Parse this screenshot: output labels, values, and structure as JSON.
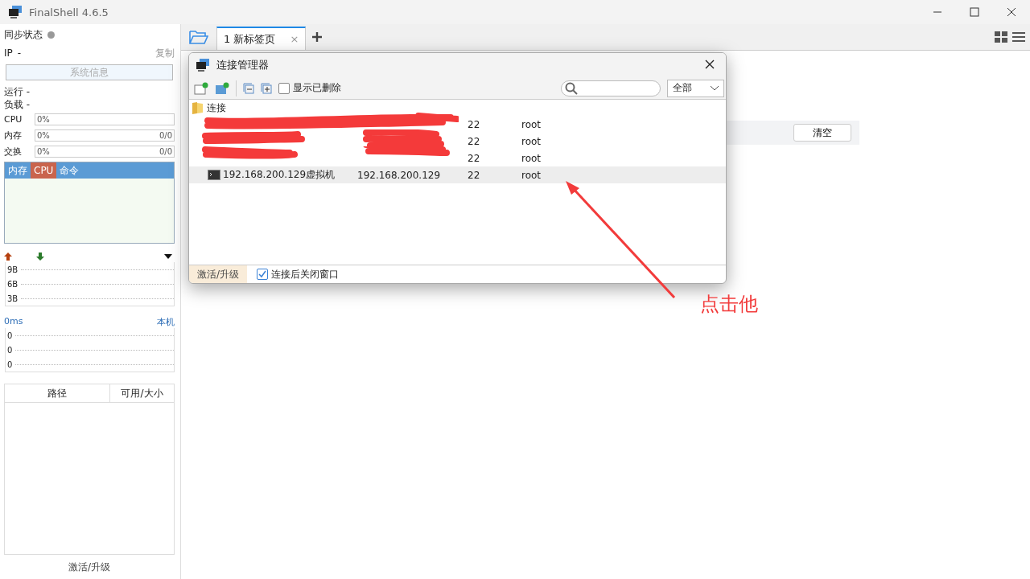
{
  "window": {
    "title": "FinalShell 4.6.5"
  },
  "sidebar": {
    "sync": {
      "label": "同步状态",
      "on": false
    },
    "ip": {
      "label": "IP",
      "value": "-",
      "action": "复制"
    },
    "sysinfo_button": "系统信息",
    "uptime": "运行 -",
    "load": "负载 -",
    "meters": [
      {
        "label": "CPU",
        "reading": "0%"
      },
      {
        "label": "内存",
        "reading": "0%",
        "extra": "0/0"
      },
      {
        "label": "交换",
        "reading": "0%",
        "extra": "0/0"
      }
    ],
    "process_tabs": [
      {
        "label": "内存",
        "selected": false
      },
      {
        "label": "CPU",
        "selected": true
      },
      {
        "label": "命令",
        "selected": false
      }
    ],
    "net_scale": [
      "9B",
      "6B",
      "3B"
    ],
    "ping": {
      "label": "0ms",
      "host": "本机",
      "scale": [
        "0",
        "0",
        "0"
      ]
    },
    "disk_columns": [
      "路径",
      "可用/大小"
    ],
    "activate": "激活/升级"
  },
  "tabs": [
    {
      "label": "1 新标签页",
      "close": "×",
      "selected": true
    }
  ],
  "background": {
    "clear_button": "清空"
  },
  "dialog": {
    "title": "连接管理器",
    "show_deleted": {
      "label": "显示已删除",
      "checked": false
    },
    "filter": "全部",
    "folder": {
      "name": "连接",
      "children": [
        {
          "port": "22",
          "user": "root",
          "redacted": true,
          "selected": false
        },
        {
          "port": "22",
          "user": "root",
          "redacted": true,
          "selected": false
        },
        {
          "port": "22",
          "user": "root",
          "redacted": true,
          "selected": false
        },
        {
          "name": "192.168.200.129虚拟机",
          "host": "192.168.200.129",
          "port": "22",
          "user": "root",
          "redacted": false,
          "selected": true
        }
      ]
    },
    "activate": "激活/升级",
    "close_after_connect": {
      "label": "连接后关闭窗口",
      "checked": true
    }
  },
  "annotation": {
    "text": "点击他"
  }
}
